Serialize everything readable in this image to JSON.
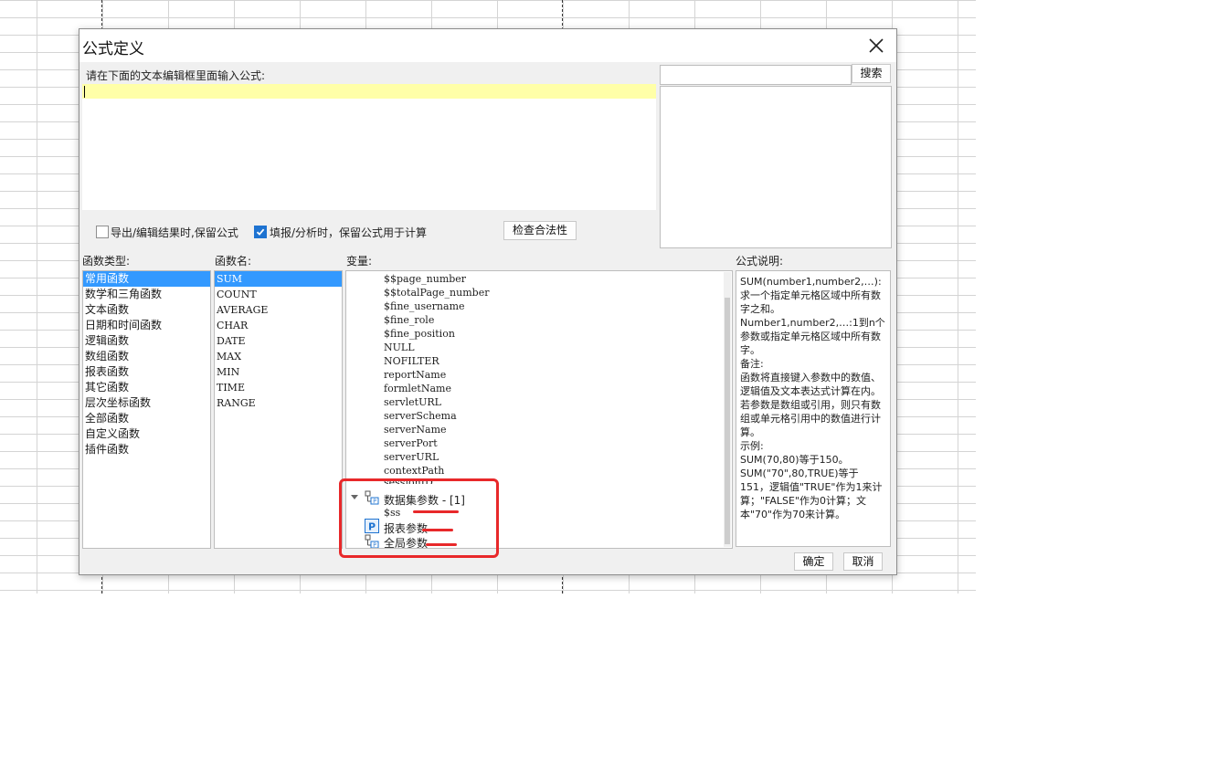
{
  "dialog": {
    "title": "公式定义",
    "editor_prompt": "请在下面的文本编辑框里面输入公式:",
    "search_button": "搜索",
    "search_placeholder": "",
    "option_keep_formula_export": "导出/编辑结果时,保留公式",
    "option_keep_formula_fill": "填报/分析时，保留公式用于计算",
    "option_keep_formula_export_checked": false,
    "option_keep_formula_fill_checked": true,
    "check_button": "检查合法性",
    "ok_button": "确定",
    "cancel_button": "取消"
  },
  "function_types": {
    "header": "函数类型:",
    "items": [
      "常用函数",
      "数学和三角函数",
      "文本函数",
      "日期和时间函数",
      "逻辑函数",
      "数组函数",
      "报表函数",
      "其它函数",
      "层次坐标函数",
      "全部函数",
      "自定义函数",
      "插件函数"
    ],
    "selected_index": 0
  },
  "function_names": {
    "header": "函数名:",
    "items": [
      "SUM",
      "COUNT",
      "AVERAGE",
      "CHAR",
      "DATE",
      "MAX",
      "MIN",
      "TIME",
      "RANGE"
    ],
    "selected_index": 0
  },
  "variables": {
    "header": "变量:",
    "items": [
      "$$page_number",
      "$$totalPage_number",
      "$fine_username",
      "$fine_role",
      "$fine_position",
      "NULL",
      "NOFILTER",
      "reportName",
      "formletName",
      "servletURL",
      "serverSchema",
      "serverName",
      "serverPort",
      "serverURL",
      "contextPath",
      "sessionID"
    ],
    "dataset_params_label": "数据集参数 - [1]",
    "dataset_param_child": "$ss",
    "report_params_label": "报表参数",
    "global_params_label": "全局参数"
  },
  "description": {
    "header": "公式说明:",
    "lines": [
      "SUM(number1,number2,…):求一个指定单元格区域中所有数字之和。",
      "Number1,number2,…:1到n个参数或指定单元格区域中所有数字。",
      "备注:",
      "函数将直接键入参数中的数值、逻辑值及文本表达式计算在内。若参数是数组或引用，则只有数组或单元格引用中的数值进行计算。",
      "示例:",
      "SUM(70,80)等于150。",
      "SUM(\"70\",80,TRUE)等于151，逻辑值\"TRUE\"作为1来计算；\"FALSE\"作为0计算；文本\"70\"作为70来计算。"
    ]
  },
  "colors": {
    "selection": "#3399ff",
    "editor_highlight": "#ffffa8",
    "annotation_red": "#e8282a",
    "checkbox_checked": "#1e73d1"
  }
}
